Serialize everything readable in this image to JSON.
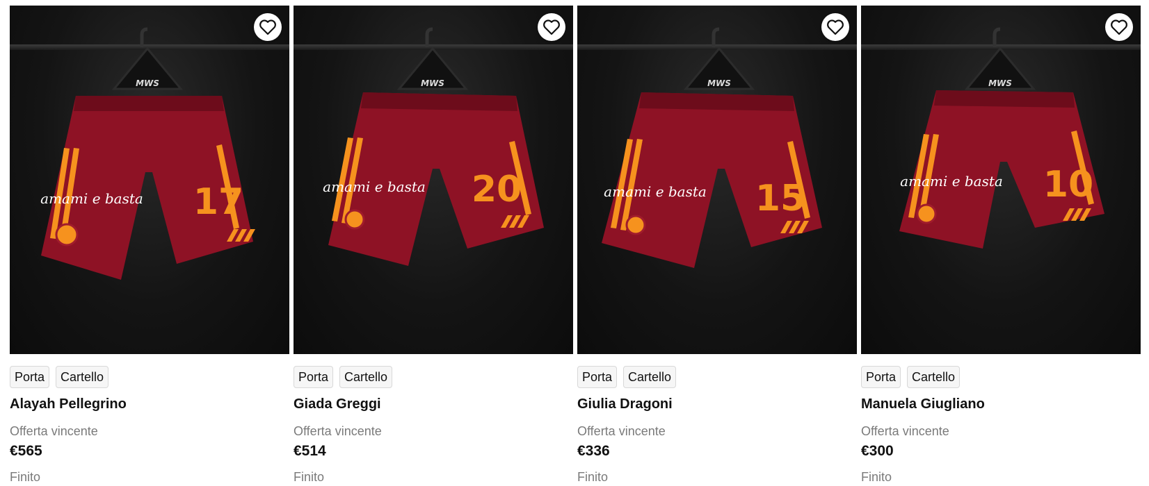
{
  "colors": {
    "shorts": "#8e1225",
    "shorts_shadow": "#6d0c1b",
    "stripe": "#f6921e",
    "background": "#141414"
  },
  "products": [
    {
      "name": "Alayah Pellegrino",
      "tags": [
        "Porta",
        "Cartello"
      ],
      "bid_label": "Offerta vincente",
      "price": "€565",
      "status": "Finito",
      "number": "17",
      "hanger_text": "MWS",
      "sponsor_text": "amami e basta"
    },
    {
      "name": "Giada Greggi",
      "tags": [
        "Porta",
        "Cartello"
      ],
      "bid_label": "Offerta vincente",
      "price": "€514",
      "status": "Finito",
      "number": "20",
      "hanger_text": "MWS",
      "sponsor_text": "amami e basta"
    },
    {
      "name": "Giulia Dragoni",
      "tags": [
        "Porta",
        "Cartello"
      ],
      "bid_label": "Offerta vincente",
      "price": "€336",
      "status": "Finito",
      "number": "15",
      "hanger_text": "MWS",
      "sponsor_text": "amami e basta"
    },
    {
      "name": "Manuela Giugliano",
      "tags": [
        "Porta",
        "Cartello"
      ],
      "bid_label": "Offerta vincente",
      "price": "€300",
      "status": "Finito",
      "number": "10",
      "hanger_text": "MWS",
      "sponsor_text": "amami e basta"
    }
  ]
}
